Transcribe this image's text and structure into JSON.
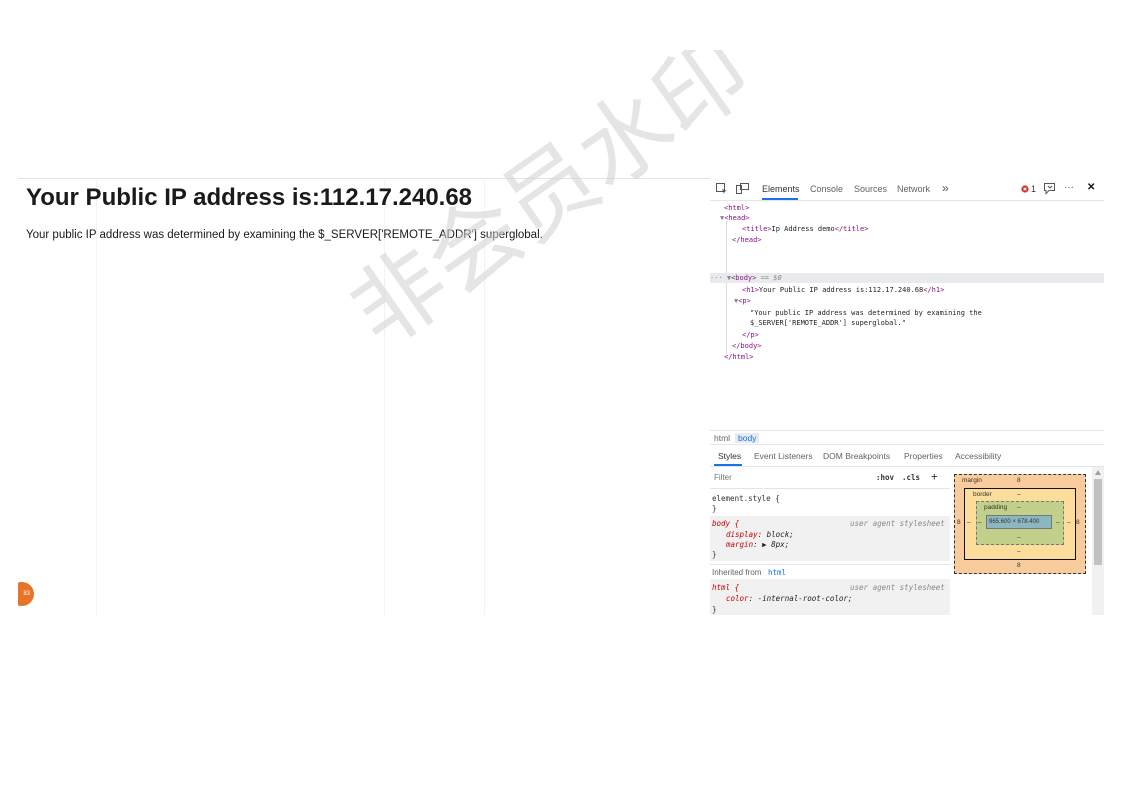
{
  "page": {
    "heading": "Your Public IP address is:112.17.240.68",
    "paragraph": "Your public IP address was determined by examining the $_SERVER['REMOTE_ADDR'] superglobal.",
    "badge": "83"
  },
  "devtools": {
    "tabs": [
      "Elements",
      "Console",
      "Sources",
      "Network"
    ],
    "more_tabs": "»",
    "error_count": "1",
    "more_menu": "···",
    "close": "✕",
    "dom": {
      "html_open": "<html>",
      "head_open": "<head>",
      "title_open": "<title>",
      "title_text": "Ip Address demo",
      "title_close": "</title>",
      "head_close": "</head>",
      "body_open": "<body>",
      "body_eq": "== $0",
      "h1_open": "<h1>",
      "h1_text": "Your Public IP address is:112.17.240.68",
      "h1_close": "</h1>",
      "p_open": "<p>",
      "p_text_1": "\"Your public IP address was determined by examining the",
      "p_text_2": "$_SERVER['REMOTE_ADDR'] superglobal.\"",
      "p_close": "</p>",
      "body_close": "</body>",
      "html_close": "</html>"
    },
    "breadcrumbs": [
      "html",
      "body"
    ],
    "subtabs": [
      "Styles",
      "Event Listeners",
      "DOM Breakpoints",
      "Properties",
      "Accessibility"
    ],
    "filter_placeholder": "Filter",
    "hov": ":hov",
    "cls": ".cls",
    "plus": "+",
    "styles": {
      "element_style": "element.style {",
      "close_brace": "}",
      "body_selector": "body {",
      "user_agent": "user agent stylesheet",
      "display_prop": "display",
      "display_val": "block;",
      "margin_prop": "margin",
      "margin_val": "8px;",
      "inherited_label": "Inherited from",
      "inherited_tag": "html",
      "html_selector": "html {",
      "color_prop": "color",
      "color_val": "-internal-root-color;"
    },
    "box_model": {
      "margin_label": "margin",
      "margin_value": "8",
      "border_label": "border",
      "border_value": "–",
      "padding_label": "padding",
      "padding_value": "–",
      "content": "965.600 × 678.400",
      "side_margin": "8",
      "side_dash": "–",
      "bottom_margin": "8",
      "bottom_dash": "–",
      "colors": {
        "margin": "#f9cc9d",
        "border": "#fddd9b",
        "padding": "#c3d08b",
        "content": "#8cb6c0"
      }
    }
  },
  "watermark": {
    "text": "非会员水印"
  }
}
